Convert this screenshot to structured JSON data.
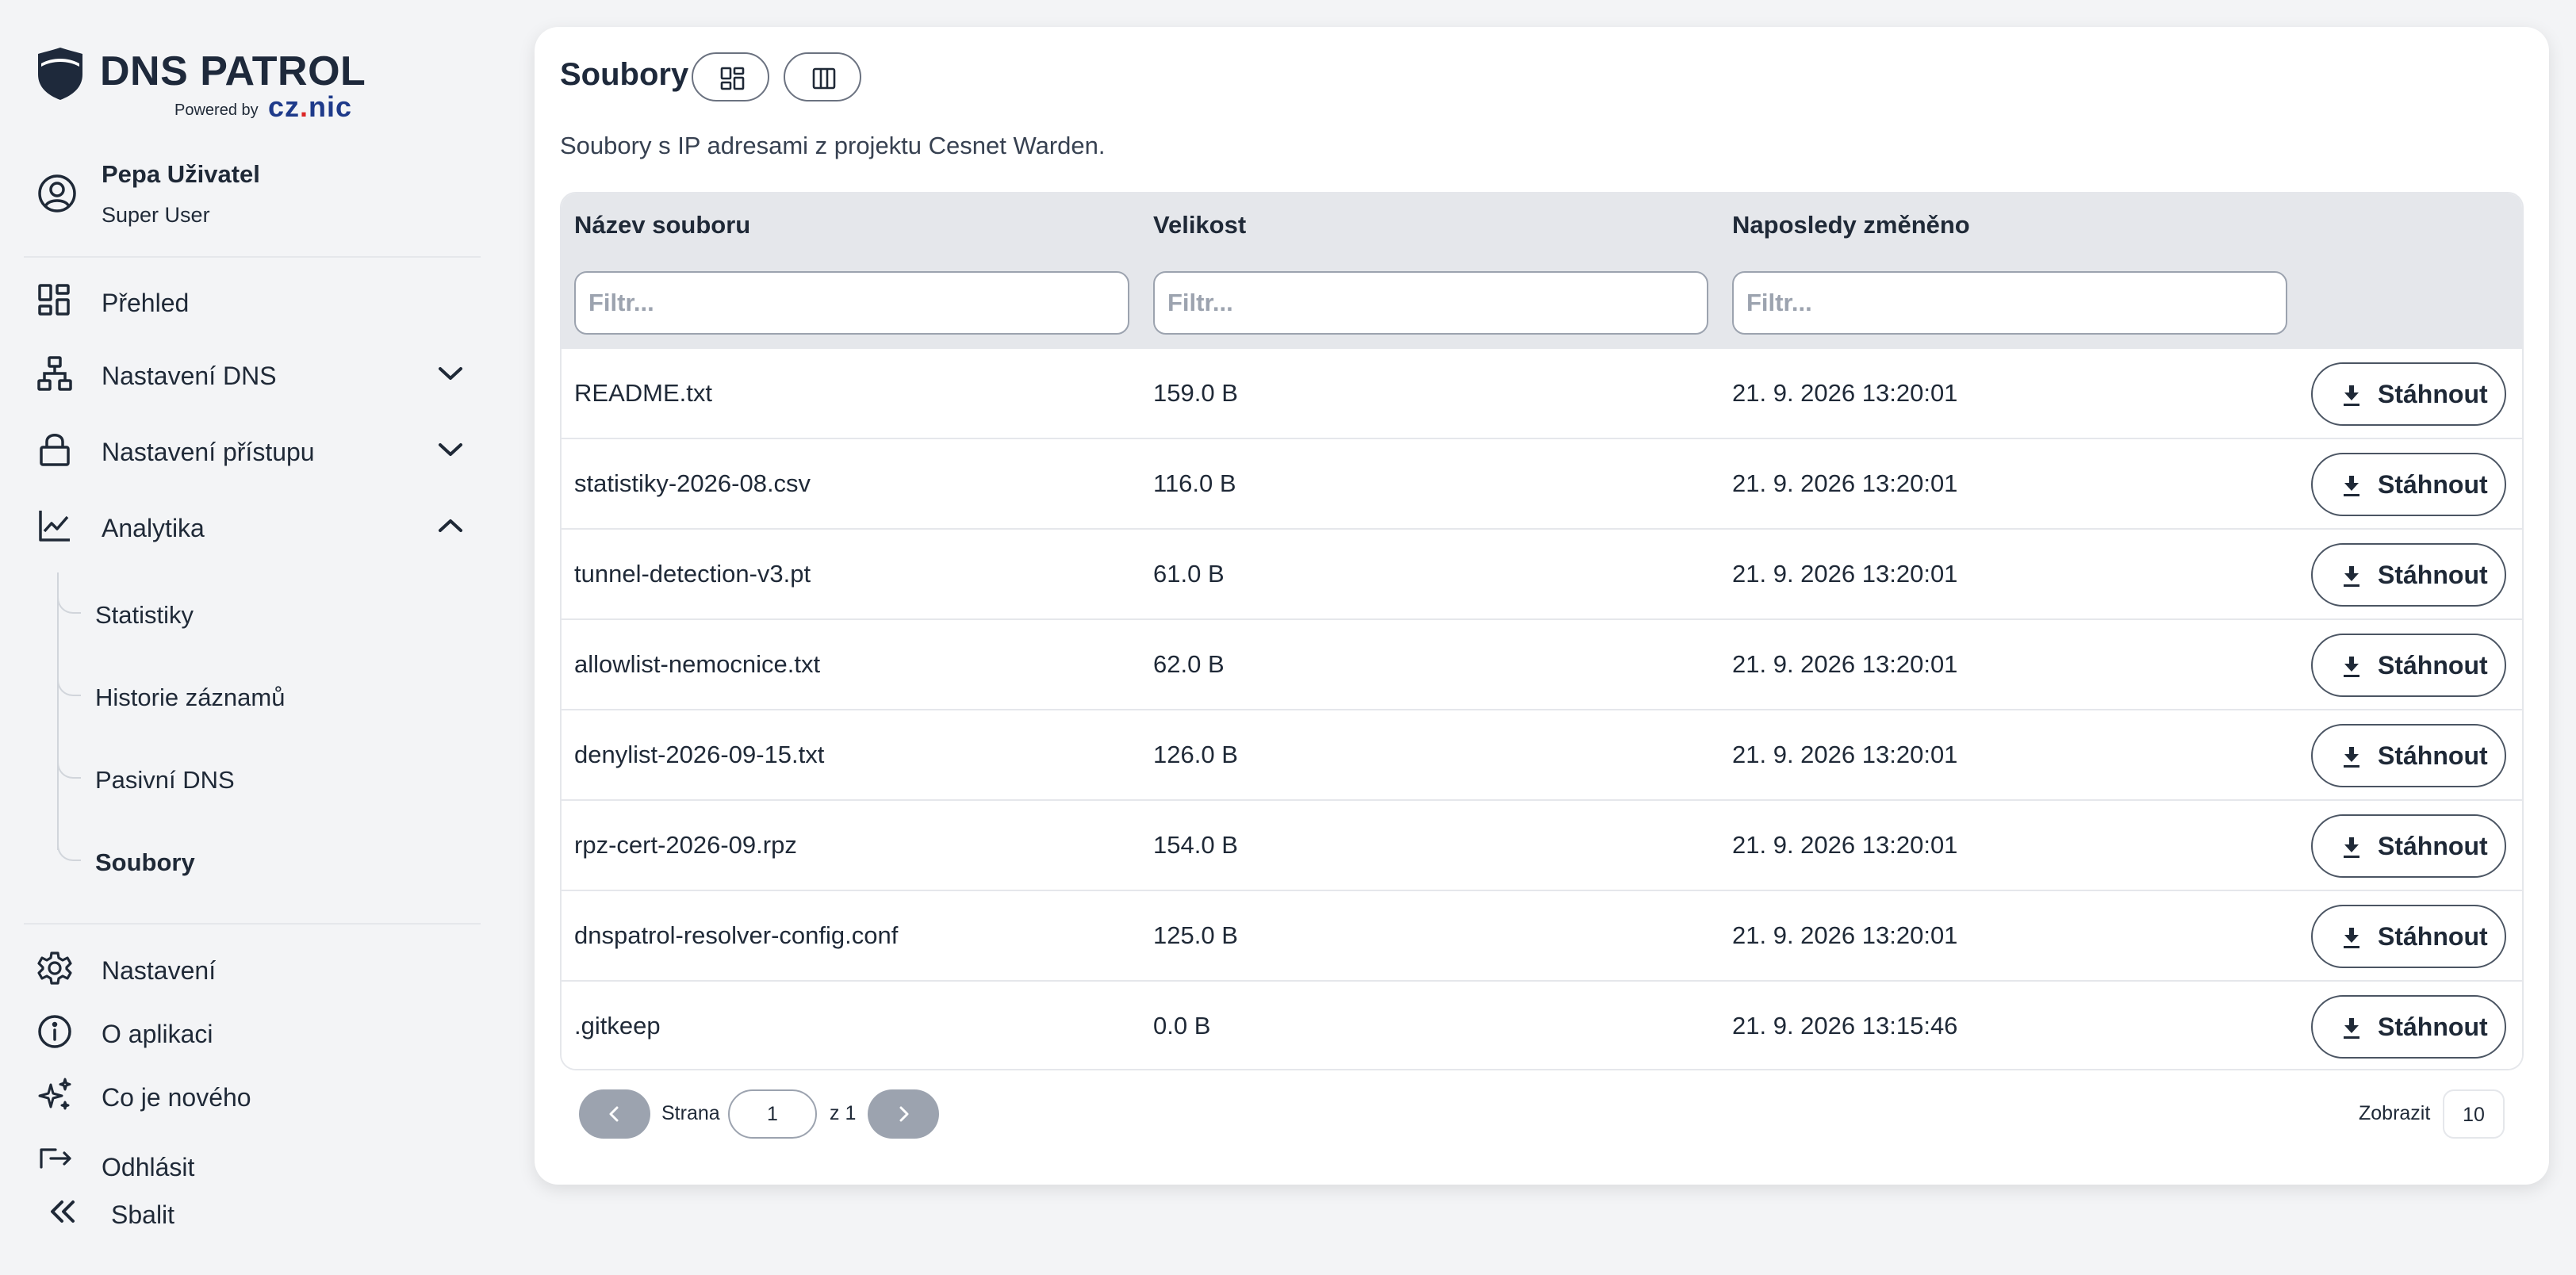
{
  "brand": {
    "title": "DNS PATROL",
    "powered_by": "Powered by",
    "partner_prefix": "cz",
    "partner_dot": ".",
    "partner_suffix": "nic"
  },
  "user": {
    "name": "Pepa Uživatel",
    "role": "Super User"
  },
  "nav": {
    "overview": "Přehled",
    "dns_settings": "Nastavení DNS",
    "access_settings": "Nastavení přístupu",
    "analytics": "Analytika",
    "analytics_items": [
      "Statistiky",
      "Historie záznamů",
      "Pasivní DNS",
      "Soubory"
    ],
    "settings": "Nastavení",
    "about": "O aplikaci",
    "whats_new": "Co je nového",
    "logout": "Odhlásit",
    "collapse": "Sbalit"
  },
  "page": {
    "title": "Soubory",
    "description": "Soubory s IP adresami z projektu Cesnet Warden."
  },
  "table": {
    "headers": {
      "name": "Název souboru",
      "size": "Velikost",
      "modified": "Naposledy změněno"
    },
    "filter_placeholder": "Filtr...",
    "download_label": "Stáhnout",
    "rows": [
      {
        "name": "README.txt",
        "size": "159.0 B",
        "modified": "21. 9. 2026 13:20:01"
      },
      {
        "name": "statistiky-2026-08.csv",
        "size": "116.0 B",
        "modified": "21. 9. 2026 13:20:01"
      },
      {
        "name": "tunnel-detection-v3.pt",
        "size": "61.0 B",
        "modified": "21. 9. 2026 13:20:01"
      },
      {
        "name": "allowlist-nemocnice.txt",
        "size": "62.0 B",
        "modified": "21. 9. 2026 13:20:01"
      },
      {
        "name": "denylist-2026-09-15.txt",
        "size": "126.0 B",
        "modified": "21. 9. 2026 13:20:01"
      },
      {
        "name": "rpz-cert-2026-09.rpz",
        "size": "154.0 B",
        "modified": "21. 9. 2026 13:20:01"
      },
      {
        "name": "dnspatrol-resolver-config.conf",
        "size": "125.0 B",
        "modified": "21. 9. 2026 13:20:01"
      },
      {
        "name": ".gitkeep",
        "size": "0.0 B",
        "modified": "21. 9. 2026 13:15:46"
      }
    ]
  },
  "pagination": {
    "page_label": "Strana",
    "current_page": "1",
    "of_label": "z 1",
    "show_label": "Zobrazit",
    "page_size": "10"
  },
  "colors": {
    "brand_dark": "#1e293b",
    "cznic_blue": "#1e3a8a",
    "cznic_dot": "#dc2626",
    "table_header_bg": "#e5e7eb",
    "pager_button": "#9ca3af"
  }
}
